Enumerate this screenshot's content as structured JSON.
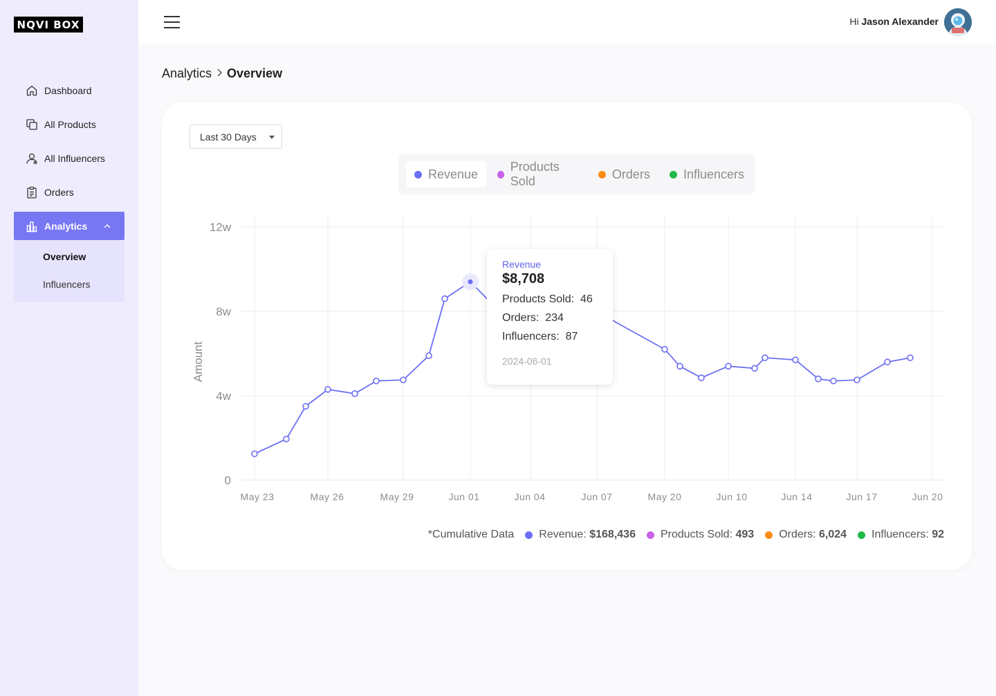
{
  "brand": {
    "logo_text": "NQVI BOX"
  },
  "sidebar": {
    "items": [
      {
        "label": "Dashboard",
        "icon": "home-icon"
      },
      {
        "label": "All Products",
        "icon": "products-icon"
      },
      {
        "label": "All Influencers",
        "icon": "user-icon"
      },
      {
        "label": "Orders",
        "icon": "clipboard-icon"
      },
      {
        "label": "Analytics",
        "icon": "bar-chart-icon",
        "expanded": true
      }
    ],
    "subitems": [
      {
        "label": "Overview",
        "selected": true
      },
      {
        "label": "Influencers"
      }
    ]
  },
  "header": {
    "greeting": "Hi",
    "user_name": "Jason Alexander"
  },
  "breadcrumb": {
    "parent": "Analytics",
    "current": "Overview"
  },
  "filter": {
    "range": "Last 30 Days"
  },
  "legend": [
    {
      "label": "Revenue",
      "color": "#6b6ff3",
      "active": true
    },
    {
      "label": "Products Sold",
      "color": "#c861e8",
      "active": false
    },
    {
      "label": "Orders",
      "color": "#fa8c16",
      "active": false
    },
    {
      "label": "Influencers",
      "color": "#22b84a",
      "active": false
    }
  ],
  "tooltip": {
    "title": "Revenue",
    "value": "$8,708",
    "products_sold_label": "Products Sold:",
    "products_sold": "46",
    "orders_label": "Orders:",
    "orders": "234",
    "influencers_label": "Influencers:",
    "influencers": "87",
    "date": "2024-06-01"
  },
  "cumulative": {
    "label": "*Cumulative Data",
    "revenue_label": "Revenue:",
    "revenue": "$168,436",
    "products_sold_label": "Products Sold:",
    "products_sold": "493",
    "orders_label": "Orders:",
    "orders": "6,024",
    "influencers_label": "Influencers:",
    "influencers": "92"
  },
  "chart_data": {
    "type": "line",
    "ylabel": "Amount",
    "y_ticks": [
      "0",
      "4w",
      "8w",
      "12w"
    ],
    "ylim": [
      0,
      120000
    ],
    "x_ticks": [
      "May 23",
      "May 26",
      "May 29",
      "Jun 01",
      "Jun 04",
      "Jun 07",
      "May 20",
      "Jun 10",
      "Jun 14",
      "Jun 17",
      "Jun 20"
    ],
    "grid": true,
    "color": "#6b6ff3",
    "series": [
      {
        "name": "Revenue",
        "values": [
          12500,
          19500,
          35000,
          43000,
          41000,
          47000,
          47500,
          59000,
          86000,
          94000,
          86000,
          82000,
          81000,
          80000,
          76000,
          62000,
          54000,
          48500,
          54000,
          53000,
          58000,
          57000,
          48000,
          47000,
          47500,
          56000,
          58000
        ],
        "highlight_index": 9
      }
    ]
  }
}
